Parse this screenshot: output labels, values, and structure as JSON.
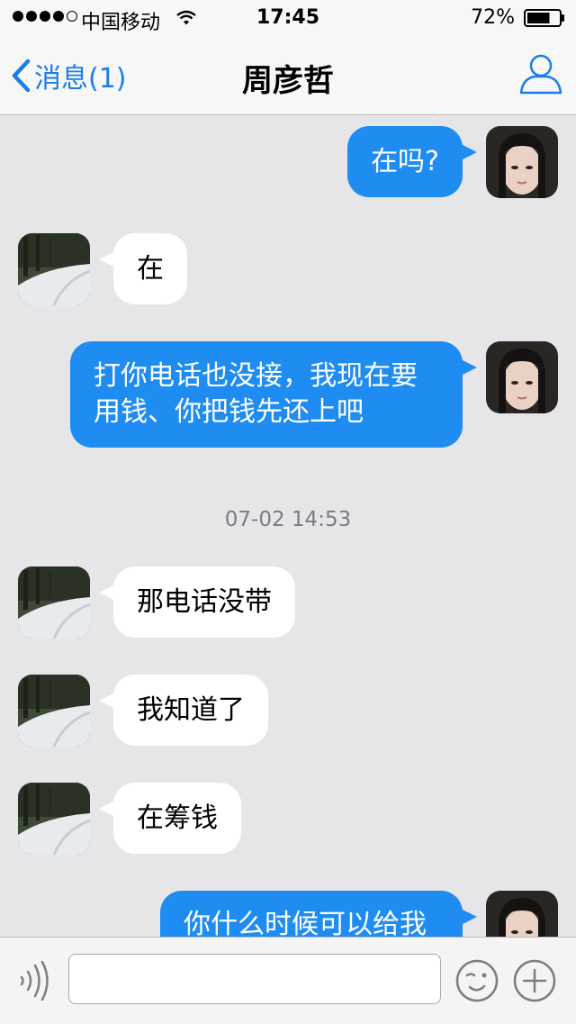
{
  "status_bar": {
    "carrier": "中国移动",
    "time": "17:45",
    "battery": "72%",
    "battery_level": 0.72,
    "signal_bars": 4,
    "signal_total": 5
  },
  "nav": {
    "back_label": "消息(1)",
    "title": "周彦哲"
  },
  "colors": {
    "accent": "#1a7ee6",
    "outgoing_bubble": "#1e8cf0",
    "incoming_bubble": "#ffffff",
    "background": "#e6e6e8"
  },
  "messages": [
    {
      "side": "out",
      "lines": [
        "在吗?"
      ]
    },
    {
      "side": "in",
      "lines": [
        "在"
      ]
    },
    {
      "side": "out",
      "lines": [
        "打你电话也没接，我现在要",
        "用钱、你把钱先还上吧"
      ]
    },
    {
      "side": "time",
      "text": "07-02 14:53"
    },
    {
      "side": "in",
      "lines": [
        "那电话没带"
      ]
    },
    {
      "side": "in",
      "lines": [
        "我知道了"
      ]
    },
    {
      "side": "in",
      "lines": [
        "在筹钱"
      ]
    },
    {
      "side": "out",
      "lines": [
        "你什么时候可以给我"
      ]
    }
  ],
  "input": {
    "placeholder": "",
    "icons": [
      "voice-icon",
      "emoji-icon",
      "plus-icon"
    ]
  }
}
